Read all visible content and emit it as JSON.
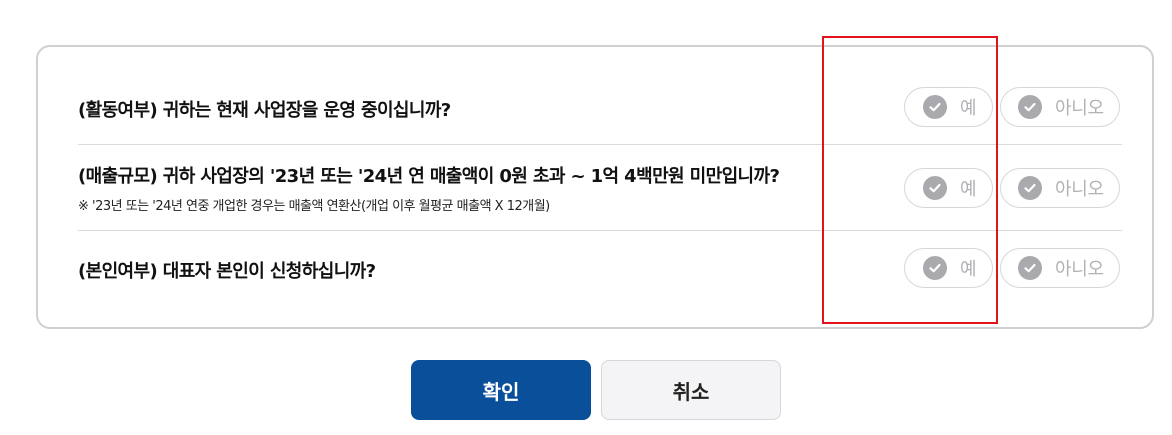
{
  "questions": [
    {
      "text": "(활동여부) 귀하는 현재 사업장을 운영 중이십니까?",
      "note": "",
      "yes_label": "예",
      "no_label": "아니오"
    },
    {
      "text": "(매출규모) 귀하 사업장의 '23년 또는 '24년 연 매출액이 0원 초과 ~ 1억 4백만원 미만입니까?",
      "note": "※ '23년 또는 '24년 연중 개업한 경우는 매출액 연환산(개업 이후 월평균 매출액 X 12개월)",
      "yes_label": "예",
      "no_label": "아니오"
    },
    {
      "text": "(본인여부) 대표자 본인이 신청하십니까?",
      "note": "",
      "yes_label": "예",
      "no_label": "아니오"
    }
  ],
  "buttons": {
    "confirm_label": "확인",
    "cancel_label": "취소"
  },
  "colors": {
    "primary": "#0a4f9a",
    "option_inactive": "#a9a9ae",
    "highlight_border": "#e2141b",
    "panel_border": "#cfcfd4"
  },
  "icons": {
    "option": "check-circle-icon"
  }
}
